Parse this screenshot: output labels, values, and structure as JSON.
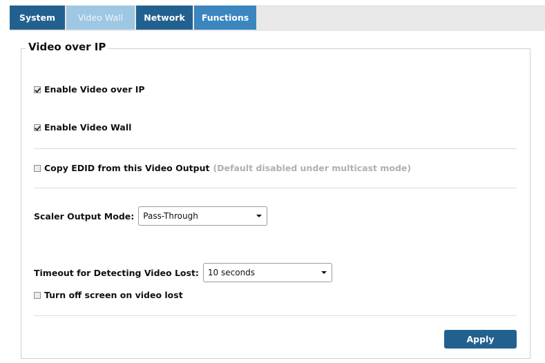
{
  "tabs": [
    {
      "label": "System",
      "active": false
    },
    {
      "label": "Video Wall",
      "active": true
    },
    {
      "label": "Network",
      "active": false
    },
    {
      "label": "Functions",
      "active": false
    }
  ],
  "section": {
    "title": "Video over IP"
  },
  "options": {
    "enable_video_over_ip": {
      "label": "Enable Video over IP",
      "checked": true
    },
    "enable_video_wall": {
      "label": "Enable Video Wall",
      "checked": true
    },
    "copy_edid": {
      "label": "Copy EDID from this Video Output",
      "note": "(Default disabled under multicast mode)",
      "checked": false
    },
    "turn_off_screen": {
      "label": "Turn off screen on video lost",
      "checked": false
    }
  },
  "scaler": {
    "label": "Scaler Output Mode:",
    "value": "Pass-Through"
  },
  "timeout": {
    "label": "Timeout for Detecting Video Lost:",
    "value": "10 seconds"
  },
  "actions": {
    "apply_label": "Apply"
  },
  "colors": {
    "tab_dark": "#22618f",
    "tab_light": "#9ec7e3",
    "tab_mid": "#3b86bf",
    "apply_bg": "#22618f"
  }
}
